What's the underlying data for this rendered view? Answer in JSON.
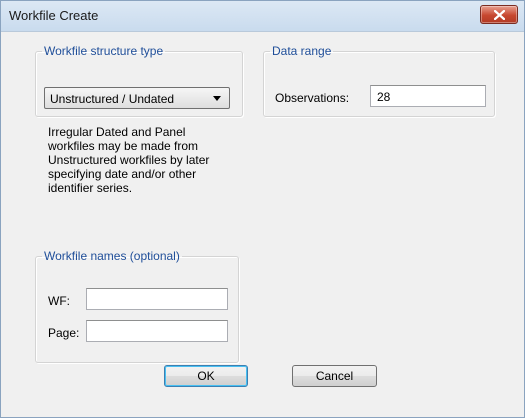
{
  "window": {
    "title": "Workfile Create"
  },
  "structure_group": {
    "legend": "Workfile structure type",
    "selected": "Unstructured / Undated"
  },
  "info_lines": [
    "Irregular Dated and Panel",
    "workfiles may be made from",
    "Unstructured workfiles by later",
    "specifying date and/or other",
    "identifier series."
  ],
  "data_range": {
    "legend": "Data range",
    "observations_label": "Observations:",
    "observations_value": "28"
  },
  "names_group": {
    "legend": "Workfile names (optional)",
    "wf_label": "WF:",
    "wf_value": "",
    "page_label": "Page:",
    "page_value": ""
  },
  "buttons": {
    "ok": "OK",
    "cancel": "Cancel"
  },
  "colors": {
    "legend_text": "#1f4e99",
    "close_button": "#c7472f",
    "dialog_background": "#f0f0f0"
  }
}
